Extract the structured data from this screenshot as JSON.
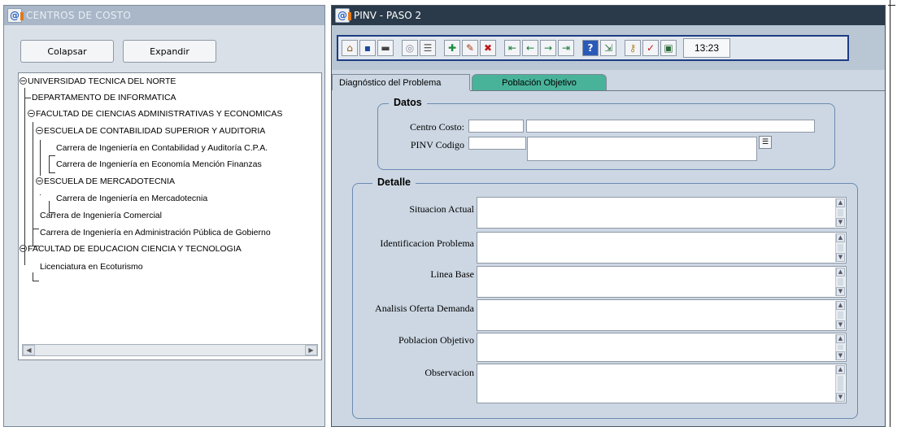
{
  "left_window": {
    "title": "CENTROS DE COSTO",
    "collapse_label": "Colapsar",
    "expand_label": "Expandir",
    "tree": [
      "UNIVERSIDAD TECNICA DEL NORTE",
      "DEPARTAMENTO DE INFORMATICA",
      "FACULTAD DE CIENCIAS ADMINISTRATIVAS Y ECONOMICAS",
      "ESCUELA DE CONTABILIDAD SUPERIOR Y AUDITORIA",
      "Carrera de Ingeniería en Contabilidad y Auditoría C.P.A.",
      "Carrera de Ingeniería en Economía Mención Finanzas",
      "ESCUELA DE MERCADOTECNIA",
      "Carrera de Ingeniería en Mercadotecnia",
      "Carrera de Ingeniería Comercial",
      "Carrera de Ingeniería en Administración Pública de Gobierno",
      "FACULTAD DE EDUCACION CIENCIA Y TECNOLOGIA",
      "Licenciatura en Ecoturismo"
    ]
  },
  "right_window": {
    "title": "PINV - PASO 2",
    "clock": "13:23",
    "toolbar_icons": [
      "broom-icon",
      "save-icon",
      "print-icon",
      "query-icon",
      "list-icon",
      "insert-record-icon",
      "edit-record-icon",
      "delete-record-icon",
      "first-record-icon",
      "previous-record-icon",
      "next-record-icon",
      "last-record-icon",
      "help-icon",
      "exit-icon",
      "key-icon",
      "check-icon",
      "calendar-icon"
    ],
    "tabs": {
      "active": "Diagnóstico del Problema",
      "inactive": "Población Objetivo"
    },
    "datos": {
      "title": "Datos",
      "centro_costo_label": "Centro Costo:",
      "centro_costo_code": "",
      "centro_costo_name": "",
      "pinv_codigo_label": "PINV Codigo",
      "pinv_codigo_code": "",
      "pinv_codigo_name": ""
    },
    "detalle": {
      "title": "Detalle",
      "fields": [
        {
          "label": "Situacion Actual",
          "value": ""
        },
        {
          "label": "Identificacion Problema",
          "value": ""
        },
        {
          "label": "Linea Base",
          "value": ""
        },
        {
          "label": "Analisis Oferta Demanda",
          "value": ""
        },
        {
          "label": "Poblacion Objetivo",
          "value": ""
        },
        {
          "label": "Observacion",
          "value": ""
        }
      ]
    }
  },
  "colors": {
    "tab_inactive": "#49b39a",
    "form_bg": "#ccd7e3",
    "titlebar_active": "#2a3a4a",
    "titlebar_inactive": "#a9b7c8"
  }
}
